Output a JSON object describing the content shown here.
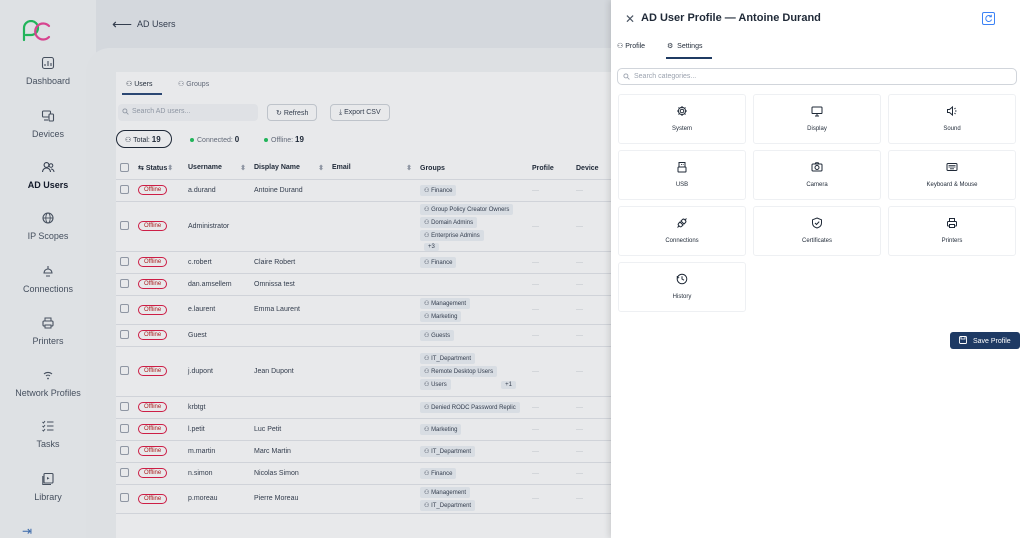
{
  "app": {
    "page_title": "AD Users",
    "nav": [
      {
        "label": "Dashboard",
        "icon": "dashboard-icon"
      },
      {
        "label": "Devices",
        "icon": "devices-icon"
      },
      {
        "label": "AD Users",
        "icon": "users-icon",
        "active": true
      },
      {
        "label": "IP Scopes",
        "icon": "globe-icon"
      },
      {
        "label": "Connections",
        "icon": "connections-icon"
      },
      {
        "label": "Printers",
        "icon": "printer-icon"
      },
      {
        "label": "Network Profiles",
        "icon": "wifi-icon"
      },
      {
        "label": "Tasks",
        "icon": "tasks-icon"
      },
      {
        "label": "Library",
        "icon": "library-icon"
      }
    ],
    "tabs": {
      "users": "Users",
      "groups": "Groups"
    },
    "search_placeholder": "Search AD users...",
    "refresh_label": "Refresh",
    "export_label": "Export CSV",
    "stats": {
      "total_label": "Total:",
      "total_value": "19",
      "connected_label": "Connected:",
      "connected_value": "0",
      "offline_label": "Offline:",
      "offline_value": "19"
    },
    "columns": {
      "status": "Status",
      "username": "Username",
      "display_name": "Display Name",
      "email": "Email",
      "groups": "Groups",
      "profile": "Profile",
      "device": "Device"
    },
    "offline_label": "Offline",
    "dash": "—",
    "rows": [
      {
        "username": "a.durand",
        "display": "Antoine Durand",
        "groups": [
          "Finance"
        ],
        "more": ""
      },
      {
        "username": "Administrator",
        "display": "",
        "groups": [
          "Group Policy Creator Owners",
          "Domain Admins",
          "Enterprise Admins"
        ],
        "more": "+3"
      },
      {
        "username": "c.robert",
        "display": "Claire Robert",
        "groups": [
          "Finance"
        ],
        "more": ""
      },
      {
        "username": "dan.amsellem",
        "display": "Omnissa test",
        "groups": [],
        "more": ""
      },
      {
        "username": "e.laurent",
        "display": "Emma Laurent",
        "groups": [
          "Management",
          "Marketing"
        ],
        "more": ""
      },
      {
        "username": "Guest",
        "display": "",
        "groups": [
          "Guests"
        ],
        "more": ""
      },
      {
        "username": "j.dupont",
        "display": "Jean Dupont",
        "groups": [
          "IT_Department",
          "Remote Desktop Users",
          "Users"
        ],
        "more": "+1"
      },
      {
        "username": "krbtgt",
        "display": "",
        "groups": [
          "Denied RODC Password Replic"
        ],
        "more": ""
      },
      {
        "username": "l.petit",
        "display": "Luc Petit",
        "groups": [
          "Marketing"
        ],
        "more": ""
      },
      {
        "username": "m.martin",
        "display": "Marc Martin",
        "groups": [
          "IT_Department"
        ],
        "more": ""
      },
      {
        "username": "n.simon",
        "display": "Nicolas Simon",
        "groups": [
          "Finance"
        ],
        "more": ""
      },
      {
        "username": "p.moreau",
        "display": "Pierre Moreau",
        "groups": [
          "Management",
          "IT_Department"
        ],
        "more": ""
      }
    ]
  },
  "drawer": {
    "title": "AD User Profile — Antoine Durand",
    "tabs": {
      "profile": "Profile",
      "settings": "Settings"
    },
    "search_placeholder": "Search categories...",
    "categories": [
      "System",
      "Display",
      "Sound",
      "USB",
      "Camera",
      "Keyboard & Mouse",
      "Connections",
      "Certificates",
      "Printers",
      "History"
    ],
    "save_label": "Save Profile"
  },
  "colors": {
    "primary": "#1e3a64",
    "offline": "#e11d48",
    "connected": "#22c55e",
    "offline_dot": "#22c55e"
  }
}
